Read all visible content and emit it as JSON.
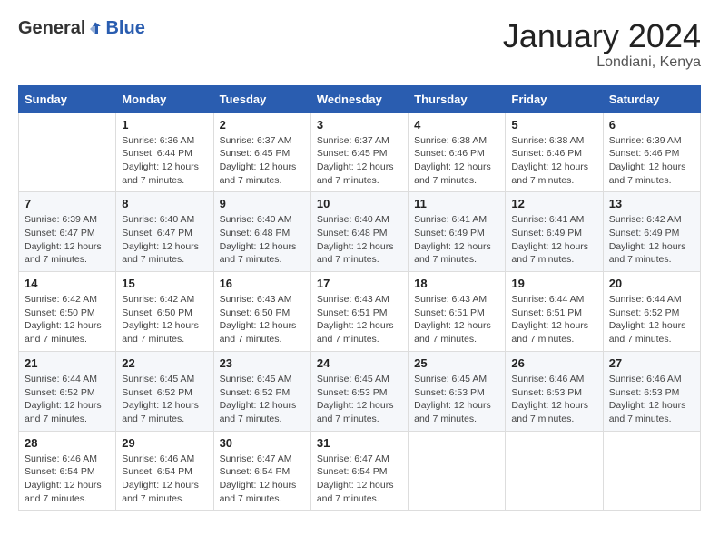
{
  "logo": {
    "general": "General",
    "blue": "Blue"
  },
  "title": {
    "month_year": "January 2024",
    "location": "Londiani, Kenya"
  },
  "weekdays": [
    "Sunday",
    "Monday",
    "Tuesday",
    "Wednesday",
    "Thursday",
    "Friday",
    "Saturday"
  ],
  "weeks": [
    [
      {
        "day": "",
        "sunrise": "",
        "sunset": "",
        "daylight": ""
      },
      {
        "day": "1",
        "sunrise": "Sunrise: 6:36 AM",
        "sunset": "Sunset: 6:44 PM",
        "daylight": "Daylight: 12 hours and 7 minutes."
      },
      {
        "day": "2",
        "sunrise": "Sunrise: 6:37 AM",
        "sunset": "Sunset: 6:45 PM",
        "daylight": "Daylight: 12 hours and 7 minutes."
      },
      {
        "day": "3",
        "sunrise": "Sunrise: 6:37 AM",
        "sunset": "Sunset: 6:45 PM",
        "daylight": "Daylight: 12 hours and 7 minutes."
      },
      {
        "day": "4",
        "sunrise": "Sunrise: 6:38 AM",
        "sunset": "Sunset: 6:46 PM",
        "daylight": "Daylight: 12 hours and 7 minutes."
      },
      {
        "day": "5",
        "sunrise": "Sunrise: 6:38 AM",
        "sunset": "Sunset: 6:46 PM",
        "daylight": "Daylight: 12 hours and 7 minutes."
      },
      {
        "day": "6",
        "sunrise": "Sunrise: 6:39 AM",
        "sunset": "Sunset: 6:46 PM",
        "daylight": "Daylight: 12 hours and 7 minutes."
      }
    ],
    [
      {
        "day": "7",
        "sunrise": "Sunrise: 6:39 AM",
        "sunset": "Sunset: 6:47 PM",
        "daylight": "Daylight: 12 hours and 7 minutes."
      },
      {
        "day": "8",
        "sunrise": "Sunrise: 6:40 AM",
        "sunset": "Sunset: 6:47 PM",
        "daylight": "Daylight: 12 hours and 7 minutes."
      },
      {
        "day": "9",
        "sunrise": "Sunrise: 6:40 AM",
        "sunset": "Sunset: 6:48 PM",
        "daylight": "Daylight: 12 hours and 7 minutes."
      },
      {
        "day": "10",
        "sunrise": "Sunrise: 6:40 AM",
        "sunset": "Sunset: 6:48 PM",
        "daylight": "Daylight: 12 hours and 7 minutes."
      },
      {
        "day": "11",
        "sunrise": "Sunrise: 6:41 AM",
        "sunset": "Sunset: 6:49 PM",
        "daylight": "Daylight: 12 hours and 7 minutes."
      },
      {
        "day": "12",
        "sunrise": "Sunrise: 6:41 AM",
        "sunset": "Sunset: 6:49 PM",
        "daylight": "Daylight: 12 hours and 7 minutes."
      },
      {
        "day": "13",
        "sunrise": "Sunrise: 6:42 AM",
        "sunset": "Sunset: 6:49 PM",
        "daylight": "Daylight: 12 hours and 7 minutes."
      }
    ],
    [
      {
        "day": "14",
        "sunrise": "Sunrise: 6:42 AM",
        "sunset": "Sunset: 6:50 PM",
        "daylight": "Daylight: 12 hours and 7 minutes."
      },
      {
        "day": "15",
        "sunrise": "Sunrise: 6:42 AM",
        "sunset": "Sunset: 6:50 PM",
        "daylight": "Daylight: 12 hours and 7 minutes."
      },
      {
        "day": "16",
        "sunrise": "Sunrise: 6:43 AM",
        "sunset": "Sunset: 6:50 PM",
        "daylight": "Daylight: 12 hours and 7 minutes."
      },
      {
        "day": "17",
        "sunrise": "Sunrise: 6:43 AM",
        "sunset": "Sunset: 6:51 PM",
        "daylight": "Daylight: 12 hours and 7 minutes."
      },
      {
        "day": "18",
        "sunrise": "Sunrise: 6:43 AM",
        "sunset": "Sunset: 6:51 PM",
        "daylight": "Daylight: 12 hours and 7 minutes."
      },
      {
        "day": "19",
        "sunrise": "Sunrise: 6:44 AM",
        "sunset": "Sunset: 6:51 PM",
        "daylight": "Daylight: 12 hours and 7 minutes."
      },
      {
        "day": "20",
        "sunrise": "Sunrise: 6:44 AM",
        "sunset": "Sunset: 6:52 PM",
        "daylight": "Daylight: 12 hours and 7 minutes."
      }
    ],
    [
      {
        "day": "21",
        "sunrise": "Sunrise: 6:44 AM",
        "sunset": "Sunset: 6:52 PM",
        "daylight": "Daylight: 12 hours and 7 minutes."
      },
      {
        "day": "22",
        "sunrise": "Sunrise: 6:45 AM",
        "sunset": "Sunset: 6:52 PM",
        "daylight": "Daylight: 12 hours and 7 minutes."
      },
      {
        "day": "23",
        "sunrise": "Sunrise: 6:45 AM",
        "sunset": "Sunset: 6:52 PM",
        "daylight": "Daylight: 12 hours and 7 minutes."
      },
      {
        "day": "24",
        "sunrise": "Sunrise: 6:45 AM",
        "sunset": "Sunset: 6:53 PM",
        "daylight": "Daylight: 12 hours and 7 minutes."
      },
      {
        "day": "25",
        "sunrise": "Sunrise: 6:45 AM",
        "sunset": "Sunset: 6:53 PM",
        "daylight": "Daylight: 12 hours and 7 minutes."
      },
      {
        "day": "26",
        "sunrise": "Sunrise: 6:46 AM",
        "sunset": "Sunset: 6:53 PM",
        "daylight": "Daylight: 12 hours and 7 minutes."
      },
      {
        "day": "27",
        "sunrise": "Sunrise: 6:46 AM",
        "sunset": "Sunset: 6:53 PM",
        "daylight": "Daylight: 12 hours and 7 minutes."
      }
    ],
    [
      {
        "day": "28",
        "sunrise": "Sunrise: 6:46 AM",
        "sunset": "Sunset: 6:54 PM",
        "daylight": "Daylight: 12 hours and 7 minutes."
      },
      {
        "day": "29",
        "sunrise": "Sunrise: 6:46 AM",
        "sunset": "Sunset: 6:54 PM",
        "daylight": "Daylight: 12 hours and 7 minutes."
      },
      {
        "day": "30",
        "sunrise": "Sunrise: 6:47 AM",
        "sunset": "Sunset: 6:54 PM",
        "daylight": "Daylight: 12 hours and 7 minutes."
      },
      {
        "day": "31",
        "sunrise": "Sunrise: 6:47 AM",
        "sunset": "Sunset: 6:54 PM",
        "daylight": "Daylight: 12 hours and 7 minutes."
      },
      {
        "day": "",
        "sunrise": "",
        "sunset": "",
        "daylight": ""
      },
      {
        "day": "",
        "sunrise": "",
        "sunset": "",
        "daylight": ""
      },
      {
        "day": "",
        "sunrise": "",
        "sunset": "",
        "daylight": ""
      }
    ]
  ]
}
